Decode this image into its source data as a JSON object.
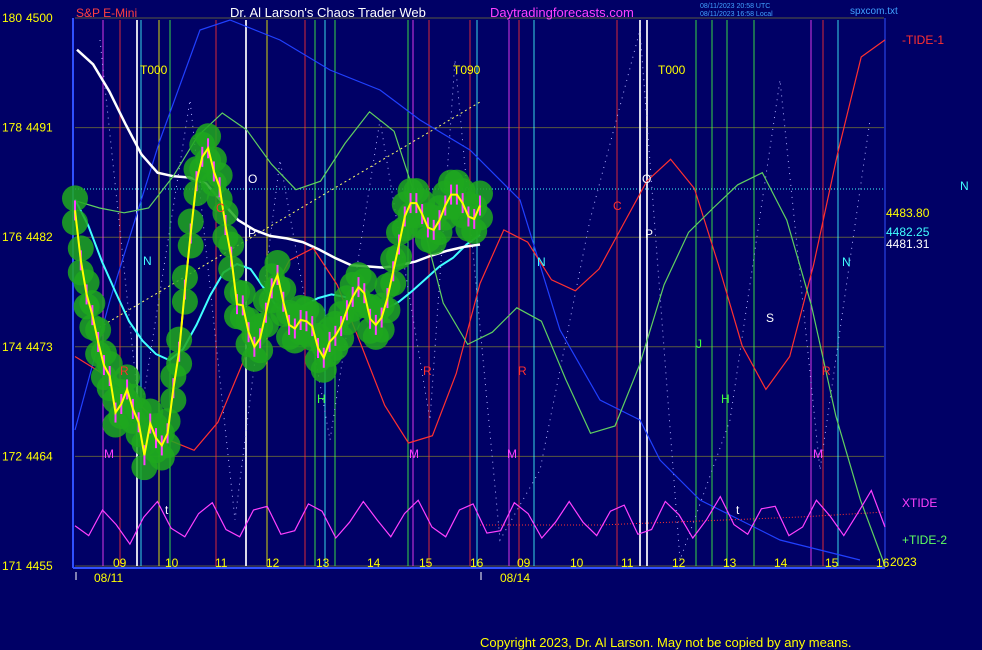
{
  "header": {
    "instrument": "S&P E-Mini",
    "title": "Dr. Al Larson's Chaos Trader Web",
    "site": "Daytradingforecasts.com",
    "timestamp_utc": "08/11/2023 20:58 UTC",
    "timestamp_local": "08/11/2023 16:58 Local",
    "file": "spxcom.txt"
  },
  "footer": {
    "copyright": "Copyright 2023, Dr. Al Larson. May not be copied by any means."
  },
  "chart_data": {
    "type": "line",
    "y_axis_labels": [
      {
        "left": "180",
        "right": "4500",
        "price": 4500
      },
      {
        "left": "178",
        "right": "4491",
        "price": 4491
      },
      {
        "left": "176",
        "right": "4482",
        "price": 4482
      },
      {
        "left": "174",
        "right": "4473",
        "price": 4473
      },
      {
        "left": "172",
        "right": "4464",
        "price": 4464
      },
      {
        "left": "171",
        "right": "4455",
        "price": 4455
      }
    ],
    "ylim": [
      4455,
      4500
    ],
    "x_hour_labels": [
      "09",
      "10",
      "11",
      "12",
      "13",
      "14",
      "15",
      "16",
      "09",
      "10",
      "11",
      "12",
      "13",
      "14",
      "15",
      "16"
    ],
    "x_date_labels": [
      "08/11",
      "08/14"
    ],
    "year_label": "2023",
    "right_values": {
      "yellow": "4483.80",
      "cyan": "4482.25",
      "white": "4481.31"
    },
    "tide_labels": {
      "tide1": "-TIDE-1",
      "xtide": "XTIDE",
      "tide2": "+TIDE-2"
    },
    "n_label": "N",
    "timing_labels": [
      "T000",
      "T090",
      "T000"
    ],
    "planet_letters": [
      "O",
      "C",
      "P",
      "N",
      "H",
      "R",
      "M",
      "t",
      "O",
      "C",
      "P",
      "N",
      "J",
      "H",
      "S",
      "R",
      "M",
      "t",
      "N",
      "R",
      "M",
      "R",
      "M"
    ],
    "series": [
      {
        "name": "price",
        "color": "#ffff00",
        "values": [
          4484.2,
          4480.1,
          4477.3,
          4475.6,
          4473.4,
          4471.5,
          4470.6,
          4467.6,
          4468.3,
          4469.5,
          4467.9,
          4466.8,
          4464.1,
          4466.7,
          4465.5,
          4464.9,
          4465.9,
          4469.6,
          4472.6,
          4477.7,
          4482.3,
          4486.6,
          4488.6,
          4489.3,
          4487.4,
          4486.1,
          4483.0,
          4480.4,
          4476.5,
          4476.4,
          4474.2,
          4473.0,
          4473.7,
          4475.8,
          4477.8,
          4478.9,
          4476.7,
          4474.8,
          4474.5,
          4475.2,
          4475.1,
          4474.7,
          4472.9,
          4472.1,
          4473.4,
          4473.9,
          4474.7,
          4476.0,
          4477.1,
          4477.9,
          4477.4,
          4475.3,
          4474.8,
          4475.4,
          4477.0,
          4479.2,
          4481.4,
          4483.7,
          4484.8,
          4484.8,
          4483.9,
          4482.8,
          4482.6,
          4483.4,
          4484.6,
          4485.5,
          4485.5,
          4484.8,
          4483.7,
          4483.5,
          4484.6
        ]
      },
      {
        "name": "cyan_avg",
        "color": "#40ffff",
        "values": [
          4485.1,
          4482.9,
          4480.0,
          4477.5,
          4475.1,
          4473.5,
          4472.4,
          4471.9,
          4472.8,
          4474.8,
          4477.2,
          4479.1,
          4479.8,
          4479.4,
          4477.8,
          4476.2,
          4475.9,
          4476.4,
          4477.0,
          4477.3,
          4477.1,
          4476.4,
          4475.9,
          4476.1,
          4476.7,
          4477.6,
          4478.6,
          4479.6,
          4480.3,
          4481.4,
          4482.2
        ]
      },
      {
        "name": "white_avg",
        "color": "#ffffff",
        "values": [
          4497.4,
          4496.2,
          4494.0,
          4491.3,
          4488.8,
          4487.3,
          4487.0,
          4486.9,
          4486.4,
          4484.9,
          4483.4,
          4482.6,
          4482.1,
          4481.9,
          4481.6,
          4481.0,
          4480.3,
          4479.7,
          4479.6,
          4479.5,
          4479.7,
          4480.0,
          4480.5,
          4480.9,
          4481.2,
          4481.4
        ]
      },
      {
        "name": "-TIDE-1",
        "color": "#ff3030",
        "values": [
          4472.2,
          4471.0,
          4469.6,
          4467.7,
          4465.3,
          4464.5,
          4466.8,
          4471.5,
          4476.4,
          4480.1,
          4481.1,
          4478.1,
          4473.2,
          4468.2,
          4465.1,
          4465.7,
          4470.8,
          4478.2,
          4482.6,
          4481.6,
          4478.5,
          4477.6,
          4479.4,
          4483.0,
          4486.6,
          4488.4,
          4486.0,
          4479.8,
          4473.1,
          4469.5,
          4472.2,
          4479.7,
          4488.8,
          4496.8,
          4498.2
        ]
      },
      {
        "name": "+TIDE-2",
        "color": "#60d060",
        "values": [
          4485.0,
          4484.4,
          4484.0,
          4484.4,
          4487.0,
          4490.3,
          4492.2,
          4490.8,
          4488.0,
          4485.9,
          4486.6,
          4489.7,
          4492.3,
          4490.7,
          4484.5,
          4476.6,
          4473.2,
          4474.2,
          4476.2,
          4475.1,
          4470.3,
          4465.9,
          4466.5,
          4471.5,
          4478.1,
          4482.4,
          4484.4,
          4486.3,
          4487.3,
          4483.4,
          4476.4,
          4467.3,
          4460.4,
          4455.0
        ]
      },
      {
        "name": "XTIDE",
        "color": "#ff40ff",
        "values": [
          4458.3,
          4457.5,
          4459.6,
          4458.4,
          4456.8,
          4459.0,
          4460.3,
          4458.1,
          4457.4,
          4459.3,
          4460.2,
          4458.0,
          4457.4,
          4459.6,
          4459.9,
          4457.6,
          4457.9,
          4460.1,
          4459.5,
          4457.3,
          4458.6,
          4460.3,
          4458.8,
          4457.4,
          4459.3,
          4460.4,
          4458.2,
          4457.4,
          4459.6,
          4460.1,
          4457.7,
          4457.9,
          4460.2,
          4459.3,
          4457.3,
          4458.6,
          4460.3,
          4458.6,
          4457.5,
          4459.5,
          4460.0,
          4457.6,
          4458.0,
          4460.3,
          4459.2,
          4457.3,
          4458.8,
          4460.7,
          4458.4,
          4457.6,
          4459.7,
          4459.9,
          4457.5,
          4458.2,
          4460.4,
          4459.1,
          4457.5,
          4459.3,
          4461.2,
          4458.2
        ]
      }
    ]
  }
}
